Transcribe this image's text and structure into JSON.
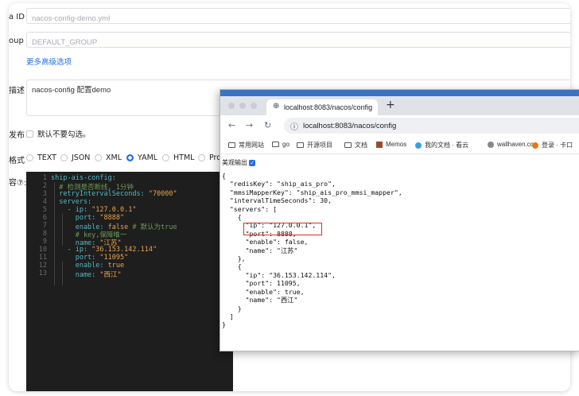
{
  "form": {
    "dataid_label": "a ID",
    "dataid_value": "nacos-config-demo.yml",
    "group_label": "oup",
    "group_value": "DEFAULT_GROUP",
    "advanced_link": "更多高级选项",
    "desc_label": "描述",
    "desc_value": "nacos-config 配置demo",
    "publish_label": "发布",
    "publish_checkbox_label": "默认不要勾选。",
    "format_label": "格式",
    "formats": [
      "TEXT",
      "JSON",
      "XML",
      "YAML",
      "HTML",
      "Prop"
    ],
    "selected_format": "YAML",
    "content_label": "容⑦:"
  },
  "editor": {
    "line_numbers": [
      "1",
      "2",
      "3",
      "4",
      "5",
      "6",
      "7",
      "8",
      "9",
      "10",
      "11",
      "12",
      "13"
    ],
    "lines": [
      "ship-ais-config:",
      "  # 检测是否断线, 1分钟",
      "  retryIntervalSeconds: \"70000\"",
      "  servers:",
      "    - ip: \"127.0.0.1\"",
      "      port: \"8888\"",
      "      enable: false # 默认为true",
      "      # key,保障唯一",
      "      name: \"江苏\"",
      "    - ip: \"36.153.142.114\"",
      "      port: \"11095\"",
      "      enable: true",
      "      name: \"西江\""
    ]
  },
  "browser": {
    "tab_title": "localhost:8083/nacos/config",
    "new_tab_icon": "plus-icon",
    "url": "localhost:8083/nacos/config",
    "bookmarks": [
      {
        "label": "常用网站",
        "icon": "folder-icon"
      },
      {
        "label": "go",
        "icon": "folder-icon"
      },
      {
        "label": "开源项目",
        "icon": "folder-icon"
      },
      {
        "label": "文档",
        "icon": "folder-icon"
      },
      {
        "label": "Memos",
        "icon": "memos-icon"
      },
      {
        "label": "我的文档 · 看云",
        "icon": "kancloud-icon"
      },
      {
        "label": "wallhaven.cc",
        "icon": "wallhaven-icon"
      },
      {
        "label": "登录 · 卡口",
        "icon": "login-icon"
      }
    ],
    "pretty_print_label": "美观输出",
    "pretty_print_checked": true,
    "json_lines": [
      "{",
      "  \"redisKey\": \"ship_ais_pro\",",
      "  \"mmsiMapperKey\": \"ship_ais_pro_mmsi_mapper\",",
      "  \"intervalTimeSeconds\": 30,",
      "  \"servers\": [",
      "    {",
      "      \"ip\": \"127.0.0.1\",",
      "      \"port\": 8888,",
      "      \"enable\": false,",
      "      \"name\": \"江苏\"",
      "    },",
      "    {",
      "      \"ip\": \"36.153.142.114\",",
      "      \"port\": 11095,",
      "      \"enable\": true,",
      "      \"name\": \"西江\"",
      "    }",
      "  ]",
      "}"
    ]
  },
  "colors": {
    "accent": "#1f6ee8",
    "highlight": "#e02b2b",
    "editor_bg": "#1e1e1e",
    "yaml_key": "#56b6c2",
    "yaml_string": "#e5a452",
    "yaml_comment": "#6a9955"
  }
}
